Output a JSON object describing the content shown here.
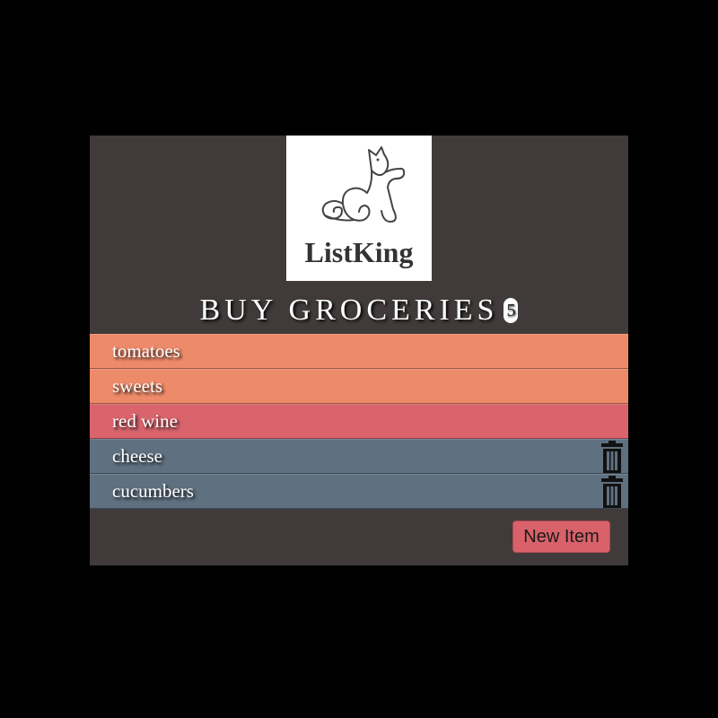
{
  "logo": {
    "icon": "cat-logo-icon",
    "text": "ListKing"
  },
  "list": {
    "title": "BUY GROCERIES",
    "count": "5",
    "items": [
      {
        "label": "tomatoes",
        "color": "#ed8a6a",
        "deletable": false
      },
      {
        "label": "sweets",
        "color": "#ed8a6a",
        "deletable": false
      },
      {
        "label": "red wine",
        "color": "#d9646c",
        "deletable": false
      },
      {
        "label": "cheese",
        "color": "#5f7080",
        "deletable": true,
        "icon": "trash-icon"
      },
      {
        "label": "cucumbers",
        "color": "#5f7080",
        "deletable": true,
        "icon": "trash-icon"
      }
    ]
  },
  "actions": {
    "new_item_label": "New Item"
  },
  "colors": {
    "panel": "#403b3a",
    "accent": "#d9626a"
  }
}
